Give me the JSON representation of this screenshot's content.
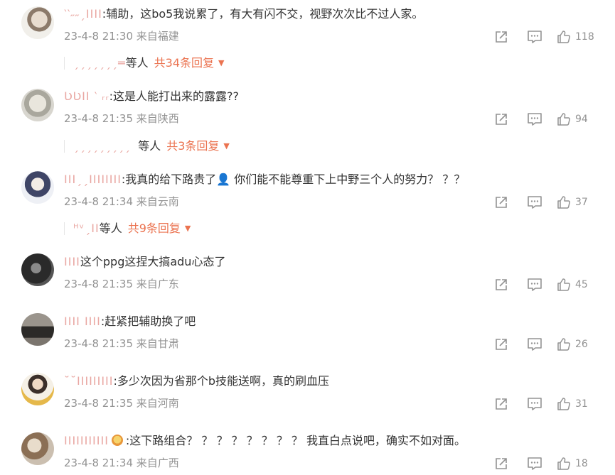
{
  "comments": [
    {
      "username": "‵‵˶˶ˏΙΙΙΙ",
      "text": ":辅助，这bo5我说累了，有大有闪不交，视野次次比不过人家。",
      "time": "23-4-8 21:30",
      "location": "来自福建",
      "likes": "118",
      "reply_users": "ˏˏˏˏˏˏˏ═",
      "reply_label": "等人",
      "reply_count": "共34条回复",
      "avatar_color": "#cfc8bf"
    },
    {
      "username": "ƲƲΙΙ ‵ ᵣᵣ",
      "text": ":这是人能打出来的露露??",
      "time": "23-4-8 21:35",
      "location": "来自陕西",
      "likes": "94",
      "reply_users": "ˏˏˏˏˏˏˏˏˏ",
      "reply_label": "等人",
      "reply_count": "共3条回复",
      "avatar_color": "#bdbdb5"
    },
    {
      "username": "ΙΙΙˏˏΙΙΙΙΙΙΙΙ",
      "text": ":我真的给下路贵了👤 你们能不能尊重下上中野三个人的努力？ ？？",
      "time": "23-4-8 21:34",
      "location": "来自云南",
      "likes": "37",
      "reply_users": "ᴴᵛˏΙΙ",
      "reply_label": "等人",
      "reply_count": "共9条回复",
      "avatar_color": "#c9cbd6"
    },
    {
      "username": "ΙΙΙΙ",
      "text": "这个ppg这捏大搞adu心态了",
      "time": "23-4-8 21:35",
      "location": "来自广东",
      "likes": "45",
      "avatar_color": "#3a3a3a"
    },
    {
      "username": "ΙΙΙΙ ΙΙΙΙ",
      "text": ":赶紧把辅助换了吧",
      "time": "23-4-8 21:35",
      "location": "来自甘肃",
      "likes": "26",
      "avatar_color": "#6b6660"
    },
    {
      "username": "˘˘ΙΙΙΙΙΙΙΙΙ",
      "text": ":多少次因为省那个b技能送啊，真的刷血压",
      "time": "23-4-8 21:35",
      "location": "来自河南",
      "likes": "31",
      "avatar_color": "#d9c07a"
    },
    {
      "username": "ΙΙΙΙΙΙΙΙΙΙΙ",
      "text": ":这下路组合？ ？ ？ ？ ？ ？ ？ ？ 我直白点说吧，确实不如对面。",
      "time": "23-4-8 21:34",
      "location": "来自广西",
      "likes": "18",
      "avatar_color": "#b8a89a"
    }
  ]
}
